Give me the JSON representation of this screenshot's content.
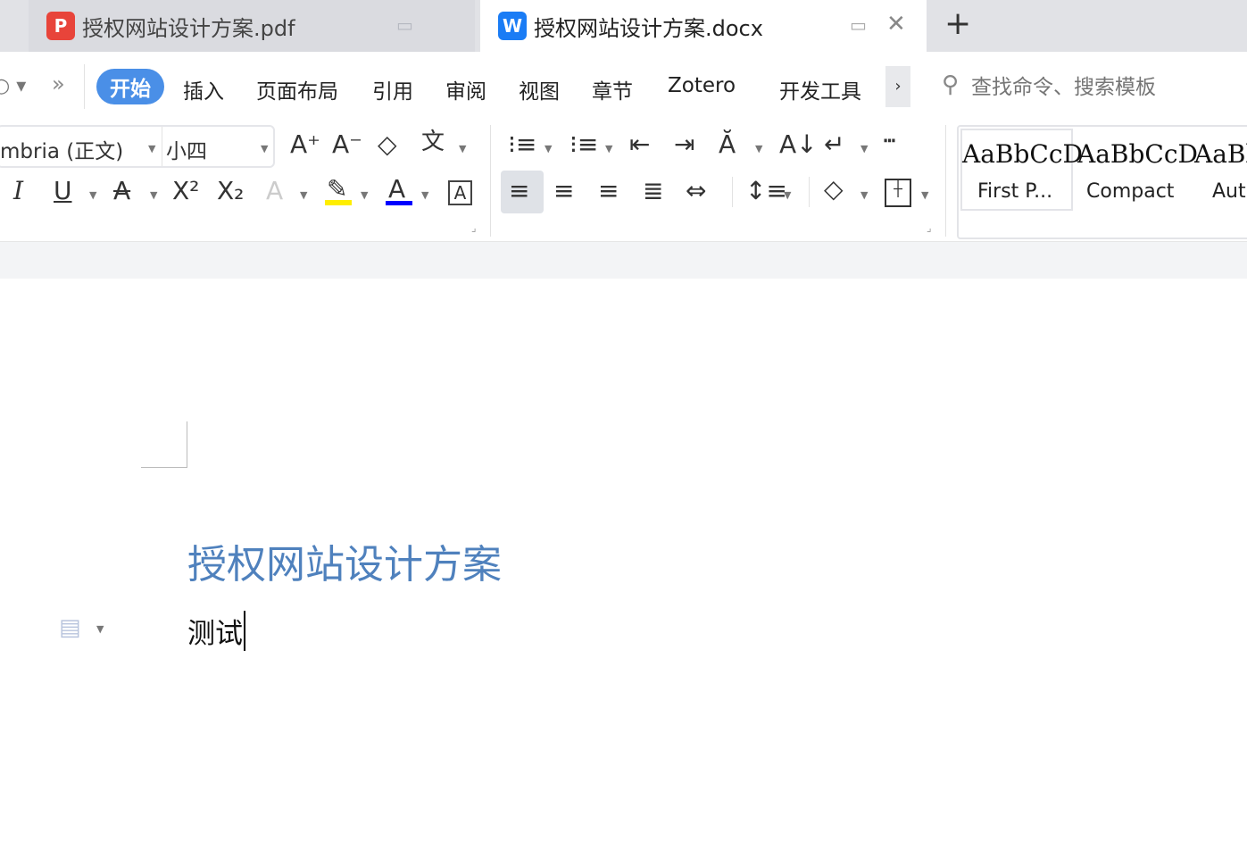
{
  "tabs": [
    {
      "label": "授权网站设计方案.pdf",
      "icon": "pdf-icon",
      "color": "#e8443a"
    },
    {
      "label": "授权网站设计方案.docx",
      "icon": "wps-writer-icon",
      "color": "#1a7cf5",
      "active": true
    }
  ],
  "new_tab": "+",
  "menu": {
    "items": [
      "开始",
      "插入",
      "页面布局",
      "引用",
      "审阅",
      "视图",
      "章节",
      "Zotero",
      "开发工具"
    ],
    "more": "›",
    "overflow": "»",
    "search_placeholder": "查找命令、搜索模板"
  },
  "font": {
    "name": "mbria (正文)",
    "size": "小四"
  },
  "styles": [
    {
      "preview": "AaBbCcD",
      "name": "First P..."
    },
    {
      "preview": "AaBbCcD",
      "name": "Compact"
    },
    {
      "preview": "AaBl",
      "name": "Aut"
    }
  ],
  "colors": {
    "accent": "#4a8fe7",
    "highlight": "#ffee00",
    "font_color": "#0000ff",
    "title_color": "#4f81bd"
  },
  "document": {
    "title": "授权网站设计方案",
    "body": "测试"
  }
}
